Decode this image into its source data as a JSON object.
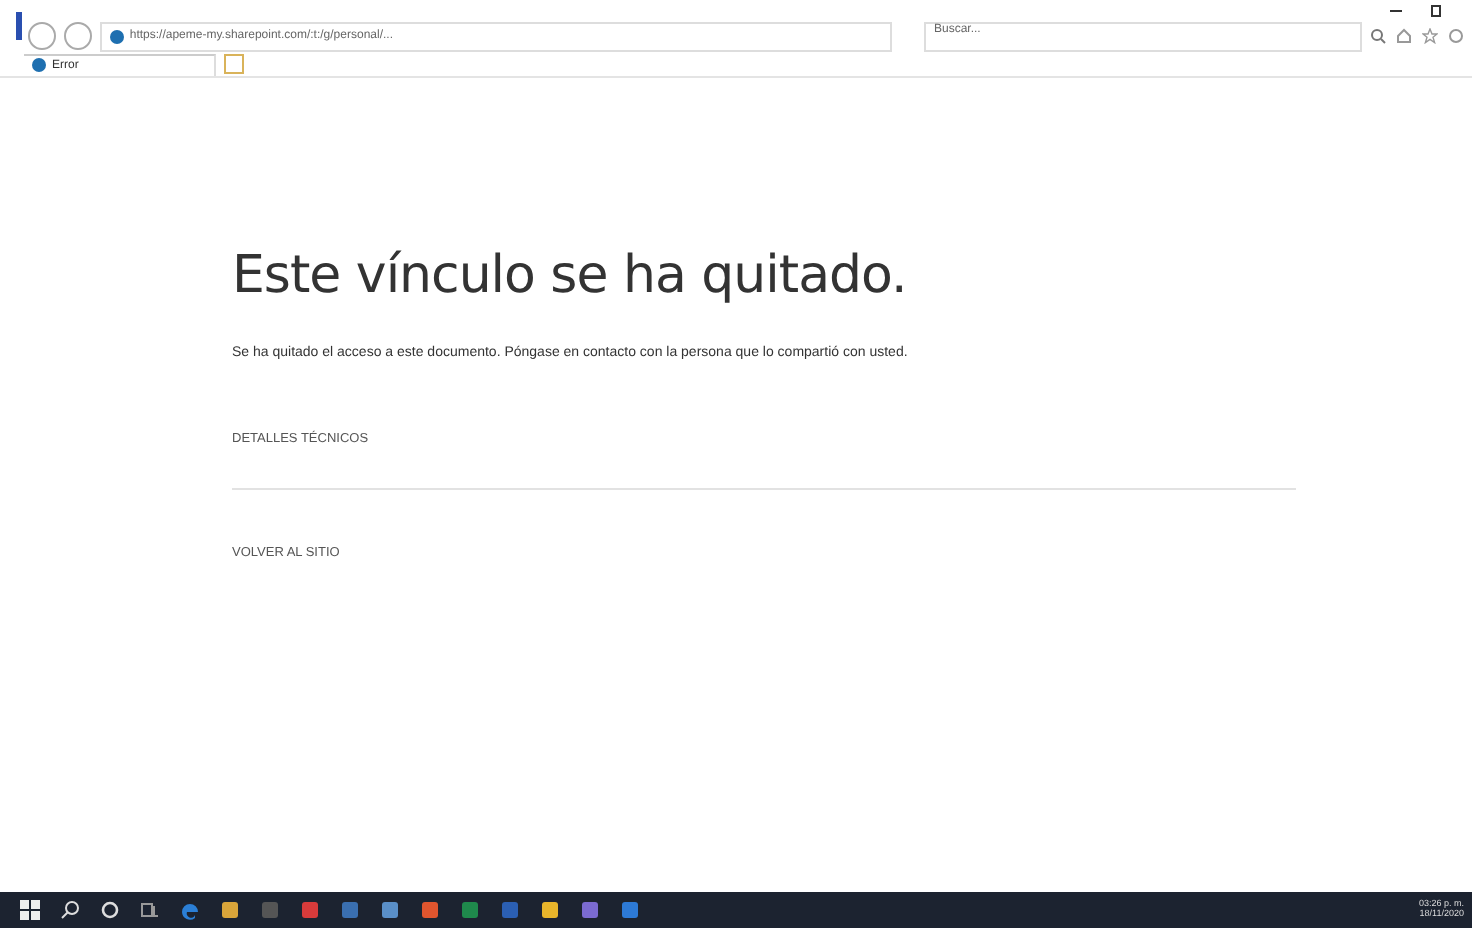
{
  "browser": {
    "url": "https://apeme-my.sharepoint.com/:t:/g/personal/...",
    "search": {
      "placeholder": "Buscar..."
    },
    "tab": {
      "title": "Error",
      "selected": true
    }
  },
  "page": {
    "heading": "Este vínculo se ha quitado.",
    "message": "Se ha quitado el acceso a este documento. Póngase en contacto con la persona que lo compartió con usted.",
    "details_link": "DETALLES TÉCNICOS",
    "back_link": "VOLVER AL SITIO"
  },
  "taskbar": {
    "apps": [
      {
        "kind": "start"
      },
      {
        "kind": "search"
      },
      {
        "kind": "cortana"
      },
      {
        "kind": "taskview"
      },
      {
        "kind": "edge",
        "color": "#2b7fd6"
      },
      {
        "kind": "app",
        "color": "#d9a53a"
      },
      {
        "kind": "app",
        "color": "#555555"
      },
      {
        "kind": "app",
        "color": "#d83b3b"
      },
      {
        "kind": "app",
        "color": "#3a6fb0"
      },
      {
        "kind": "app",
        "color": "#5a8fc8"
      },
      {
        "kind": "app",
        "color": "#e0552e"
      },
      {
        "kind": "app",
        "color": "#1f8a4c"
      },
      {
        "kind": "app",
        "color": "#2b5fb3"
      },
      {
        "kind": "app",
        "color": "#e8b52b"
      },
      {
        "kind": "app",
        "color": "#7b6bd1"
      },
      {
        "kind": "app",
        "color": "#2d7ad6"
      }
    ],
    "time": "03:26 p. m.",
    "date": "18/11/2020"
  }
}
